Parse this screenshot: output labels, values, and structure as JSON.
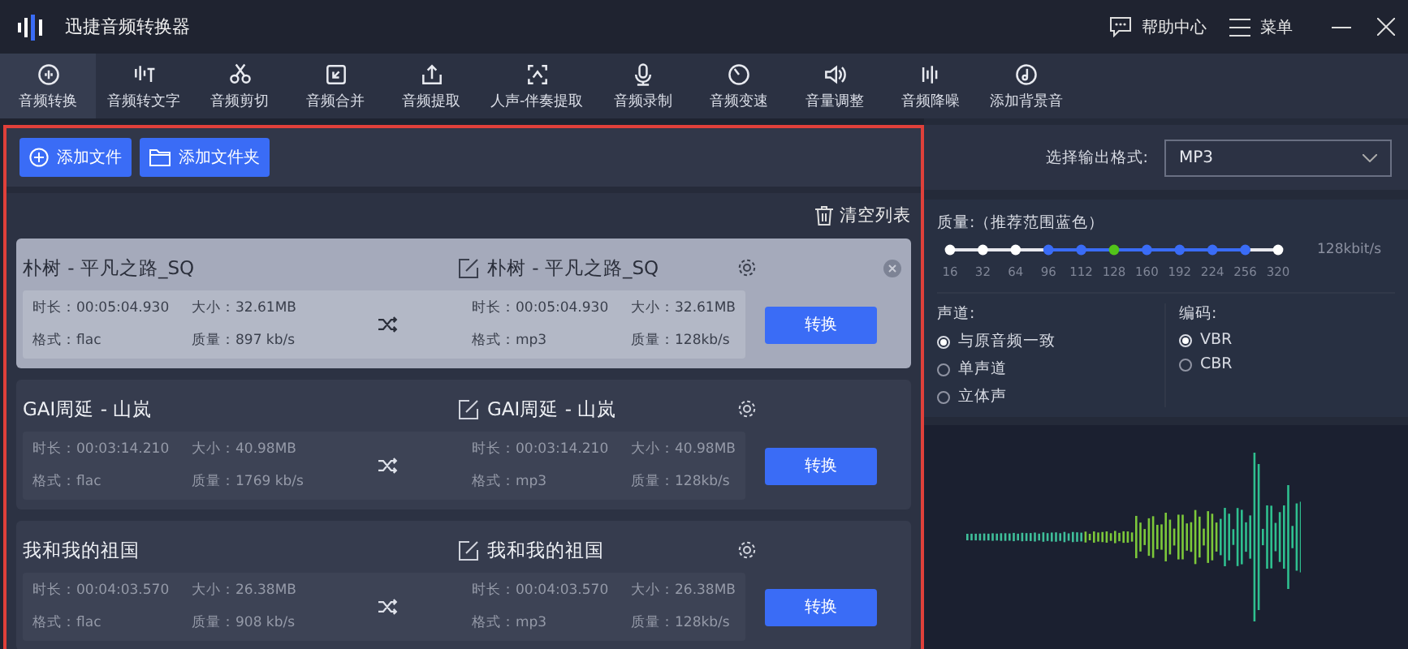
{
  "window": {
    "title": "迅捷音频转换器",
    "help": "帮助中心",
    "menu": "菜单"
  },
  "tabs": [
    {
      "label": "音频转换",
      "selected": true
    },
    {
      "label": "音频转文字",
      "selected": false
    },
    {
      "label": "音频剪切",
      "selected": false
    },
    {
      "label": "音频合并",
      "selected": false
    },
    {
      "label": "音频提取",
      "selected": false
    },
    {
      "label": "人声-伴奏提取",
      "selected": false
    },
    {
      "label": "音频录制",
      "selected": false
    },
    {
      "label": "音频变速",
      "selected": false
    },
    {
      "label": "音量调整",
      "selected": false
    },
    {
      "label": "音频降噪",
      "selected": false
    },
    {
      "label": "添加背景音",
      "selected": false
    }
  ],
  "add_file": "添加文件",
  "add_folder": "添加文件夹",
  "clear_list": "清空列表",
  "files": [
    {
      "selected": true,
      "name": "朴树 - 平凡之路_SQ",
      "src": [
        "时长：00:05:04.930",
        "大小：32.61MB",
        "格式：flac",
        "质量：897 kb/s"
      ],
      "out_name": "朴树 - 平凡之路_SQ",
      "out": [
        "时长：00:05:04.930",
        "大小：32.61MB",
        "格式：mp3",
        "质量：128kb/s"
      ],
      "button": "转换"
    },
    {
      "selected": false,
      "name": "GAI周延 - 山岚",
      "src": [
        "时长：00:03:14.210",
        "大小：40.98MB",
        "格式：flac",
        "质量：1769 kb/s"
      ],
      "out_name": "GAI周延 - 山岚",
      "out": [
        "时长：00:03:14.210",
        "大小：40.98MB",
        "格式：mp3",
        "质量：128kb/s"
      ],
      "button": "转换"
    },
    {
      "selected": false,
      "name": "我和我的祖国",
      "src": [
        "时长：00:04:03.570",
        "大小：26.38MB",
        "格式：flac",
        "质量：908 kb/s"
      ],
      "out_name": "我和我的祖国",
      "out": [
        "时长：00:04:03.570",
        "大小：26.38MB",
        "格式：mp3",
        "质量：128kb/s"
      ],
      "button": "转换"
    }
  ],
  "output_format": {
    "label": "选择输出格式:",
    "value": "MP3"
  },
  "quality": {
    "label": "质量:（推荐范围蓝色）",
    "reading": "128kbit/s",
    "ticks": [
      {
        "label": "16",
        "recommended": false,
        "selected": false
      },
      {
        "label": "32",
        "recommended": false,
        "selected": false
      },
      {
        "label": "64",
        "recommended": false,
        "selected": false
      },
      {
        "label": "96",
        "recommended": true,
        "selected": false
      },
      {
        "label": "112",
        "recommended": true,
        "selected": false
      },
      {
        "label": "128",
        "recommended": true,
        "selected": true
      },
      {
        "label": "160",
        "recommended": true,
        "selected": false
      },
      {
        "label": "192",
        "recommended": true,
        "selected": false
      },
      {
        "label": "224",
        "recommended": true,
        "selected": false
      },
      {
        "label": "256",
        "recommended": true,
        "selected": false
      },
      {
        "label": "320",
        "recommended": false,
        "selected": false
      }
    ]
  },
  "channel": {
    "label": "声道:",
    "options": [
      {
        "label": "与原音频一致",
        "selected": true
      },
      {
        "label": "单声道",
        "selected": false
      },
      {
        "label": "立体声",
        "selected": false
      }
    ]
  },
  "encoding": {
    "label": "编码:",
    "options": [
      {
        "label": "VBR",
        "selected": true
      },
      {
        "label": "CBR",
        "selected": false
      }
    ]
  }
}
